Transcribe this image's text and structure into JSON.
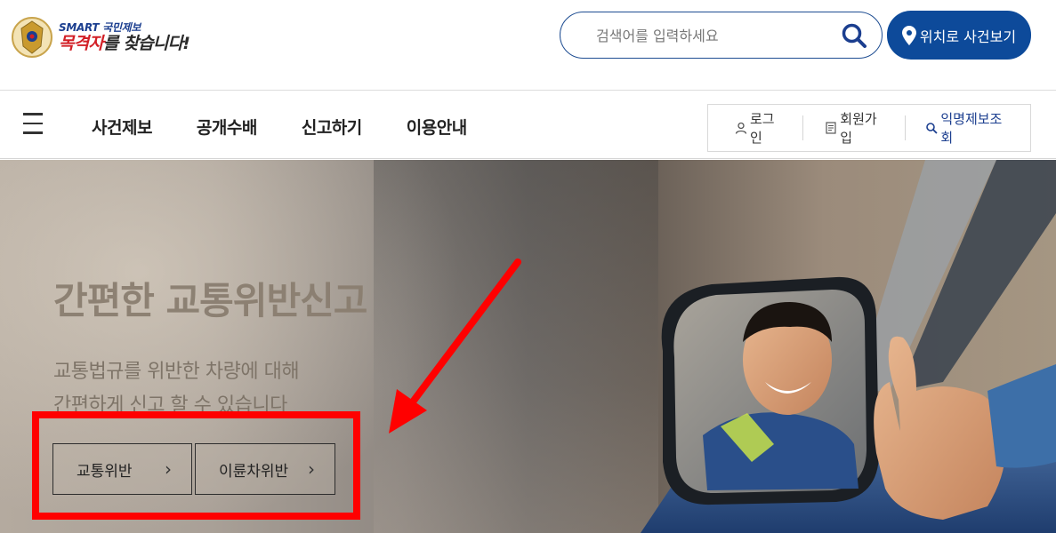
{
  "header": {
    "logo_line1_part1": "SMART",
    "logo_line1_part2": "국민제보",
    "logo_line2_red": "목격자",
    "logo_line2_rest": "를 찾습니다!",
    "search_placeholder": "검색어를 입력하세요",
    "location_button": "위치로 사건보기"
  },
  "nav": {
    "menu": [
      "사건제보",
      "공개수배",
      "신고하기",
      "이용안내"
    ],
    "login": "로그인",
    "signup": "회원가입",
    "anonymous_lookup": "익명제보조회"
  },
  "hero": {
    "title": "간편한 교통위반신고",
    "subtitle_line1": "교통법규를 위반한 차량에 대해",
    "subtitle_line2": "간편하게 신고 할 수 있습니다",
    "button_traffic": "교통위반",
    "button_lamborghini": "이륜차위반",
    "chevron": "›"
  },
  "colors": {
    "brand_blue": "#0d4a9a",
    "annotation_red": "#ff0000",
    "logo_red": "#d21f26"
  }
}
